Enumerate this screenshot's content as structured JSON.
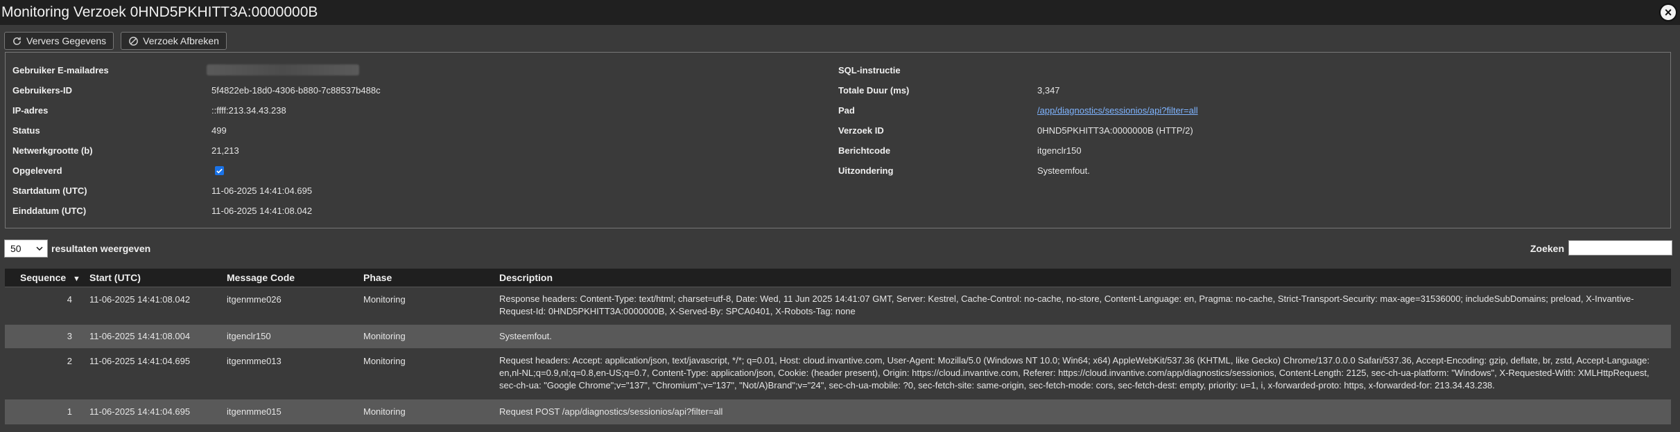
{
  "window": {
    "title": "Monitoring Verzoek 0HND5PKHITT3A:0000000B",
    "close_icon": "close-icon"
  },
  "toolbar": {
    "refresh_label": "Ververs Gegevens",
    "refresh_icon": "refresh-icon",
    "abort_label": "Verzoek Afbreken",
    "abort_icon": "cancel-icon"
  },
  "details_left": {
    "email_label": "Gebruiker E-mailadres",
    "user_id_label": "Gebruikers-ID",
    "user_id": "5f4822eb-18d0-4306-b880-7c88537b488c",
    "ip_label": "IP-adres",
    "ip": "::ffff:213.34.43.238",
    "status_label": "Status",
    "status": "499",
    "netsize_label": "Netwerkgrootte (b)",
    "netsize": "21,213",
    "delivered_label": "Opgeleverd",
    "start_label": "Startdatum (UTC)",
    "start": "11-06-2025 14:41:04.695",
    "end_label": "Einddatum (UTC)",
    "end": "11-06-2025 14:41:08.042"
  },
  "details_right": {
    "sql_label": "SQL-instructie",
    "duration_label": "Totale Duur (ms)",
    "duration": "3,347",
    "path_label": "Pad",
    "path": "/app/diagnostics/sessionios/api?filter=all",
    "request_id_label": "Verzoek ID",
    "request_id": "0HND5PKHITT3A:0000000B (HTTP/2)",
    "message_code_label": "Berichtcode",
    "message_code": "itgenclr150",
    "exception_label": "Uitzondering",
    "exception": "Systeemfout."
  },
  "controls": {
    "page_length": "50",
    "page_length_label": "resultaten weergeven",
    "search_label": "Zoeken",
    "search_value": ""
  },
  "table": {
    "headers": {
      "sequence": "Sequence",
      "sort_icon": "▼",
      "start": "Start (UTC)",
      "message_code": "Message Code",
      "phase": "Phase",
      "description": "Description"
    },
    "rows": [
      {
        "sequence": "4",
        "start": "11-06-2025 14:41:08.042",
        "message_code": "itgenmme026",
        "phase": "Monitoring",
        "description": "Response headers: Content-Type: text/html; charset=utf-8, Date: Wed, 11 Jun 2025 14:41:07 GMT, Server: Kestrel, Cache-Control: no-cache, no-store, Content-Language: en, Pragma: no-cache, Strict-Transport-Security: max-age=31536000; includeSubDomains; preload, X-Invantive-Request-Id: 0HND5PKHITT3A:0000000B, X-Served-By: SPCA0401, X-Robots-Tag: none"
      },
      {
        "sequence": "3",
        "start": "11-06-2025 14:41:08.004",
        "message_code": "itgenclr150",
        "phase": "Monitoring",
        "description": "Systeemfout."
      },
      {
        "sequence": "2",
        "start": "11-06-2025 14:41:04.695",
        "message_code": "itgenmme013",
        "phase": "Monitoring",
        "description": "Request headers: Accept: application/json, text/javascript, */*; q=0.01, Host: cloud.invantive.com, User-Agent: Mozilla/5.0 (Windows NT 10.0; Win64; x64) AppleWebKit/537.36 (KHTML, like Gecko) Chrome/137.0.0.0 Safari/537.36, Accept-Encoding: gzip, deflate, br, zstd, Accept-Language: en,nl-NL;q=0.9,nl;q=0.8,en-US;q=0.7, Content-Type: application/json, Cookie: (header present), Origin: https://cloud.invantive.com, Referer: https://cloud.invantive.com/app/diagnostics/sessionios, Content-Length: 2125, sec-ch-ua-platform: \"Windows\", X-Requested-With: XMLHttpRequest, sec-ch-ua: \"Google Chrome\";v=\"137\", \"Chromium\";v=\"137\", \"Not/A)Brand\";v=\"24\", sec-ch-ua-mobile: ?0, sec-fetch-site: same-origin, sec-fetch-mode: cors, sec-fetch-dest: empty, priority: u=1, i, x-forwarded-proto: https, x-forwarded-for: 213.34.43.238."
      },
      {
        "sequence": "1",
        "start": "11-06-2025 14:41:04.695",
        "message_code": "itgenmme015",
        "phase": "Monitoring",
        "description": "Request POST /app/diagnostics/sessionios/api?filter=all"
      }
    ]
  }
}
